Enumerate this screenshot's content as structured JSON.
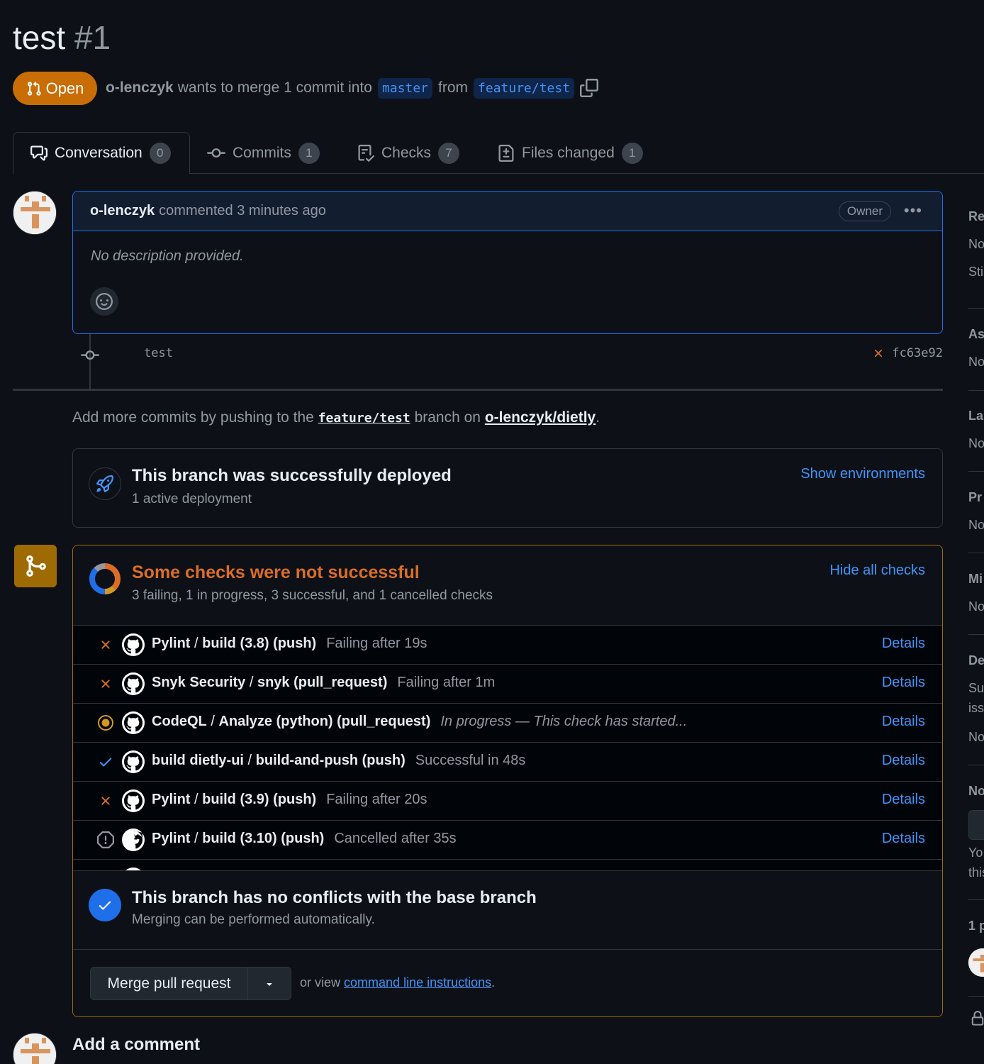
{
  "pr": {
    "title": "test",
    "number": "#1",
    "state": "Open",
    "author": "o-lenczyk",
    "meta_text": "wants to merge 1 commit into",
    "base_branch": "master",
    "from_text": "from",
    "head_branch": "feature/test"
  },
  "tabs": [
    {
      "label": "Conversation",
      "count": "0",
      "icon": "comment-discussion-icon"
    },
    {
      "label": "Commits",
      "count": "1",
      "icon": "git-commit-icon"
    },
    {
      "label": "Checks",
      "count": "7",
      "icon": "checklist-icon"
    },
    {
      "label": "Files changed",
      "count": "1",
      "icon": "file-diff-icon"
    }
  ],
  "comment": {
    "author": "o-lenczyk",
    "action": "commented 3 minutes ago",
    "badge": "Owner",
    "body": "No description provided."
  },
  "commit": {
    "message": "test",
    "sha": "fc63e92"
  },
  "push_hint": {
    "before": "Add more commits by pushing to the",
    "branch": "feature/test",
    "middle": "branch on",
    "owner": "o-lenczyk",
    "slash": "/",
    "repo": "dietly",
    "after": "."
  },
  "deployment": {
    "title": "This branch was successfully deployed",
    "subtitle": "1 active deployment",
    "link": "Show environments"
  },
  "checks": {
    "title": "Some checks were not successful",
    "subtitle": "3 failing, 1 in progress, 3 successful, and 1 cancelled checks",
    "link": "Hide all checks",
    "items": [
      {
        "status": "failing",
        "workflow": "Pylint",
        "job": "build (3.8) (push)",
        "desc": "Failing after 19s",
        "details": "Details"
      },
      {
        "status": "failing",
        "workflow": "Snyk Security",
        "job": "snyk (pull_request)",
        "desc": "Failing after 1m",
        "details": "Details"
      },
      {
        "status": "in-progress",
        "workflow": "CodeQL",
        "job": "Analyze (python) (pull_request)",
        "desc": "In progress — This check has started...",
        "details": "Details"
      },
      {
        "status": "success",
        "workflow": "build dietly-ui",
        "job": "build-and-push (push)",
        "desc": "Successful in 48s",
        "details": "Details"
      },
      {
        "status": "failing",
        "workflow": "Pylint",
        "job": "build (3.9) (push)",
        "desc": "Failing after 20s",
        "details": "Details"
      },
      {
        "status": "cancelled",
        "workflow": "Pylint",
        "job": "build (3.10) (push)",
        "desc": "Cancelled after 35s",
        "details": "Details"
      }
    ]
  },
  "conflicts": {
    "title": "This branch has no conflicts with the base branch",
    "subtitle": "Merging can be performed automatically."
  },
  "merge": {
    "button": "Merge pull request",
    "hint_before": "or view",
    "hint_link": "command line instructions",
    "hint_after": "."
  },
  "add_comment": "Add a comment",
  "sidebar": {
    "items": [
      "Re",
      "No",
      "Sti",
      "As",
      "No",
      "La",
      "No",
      "Pr",
      "No",
      "Mi",
      "No",
      "De",
      "Su",
      "iss",
      "No",
      "No",
      "Yo",
      "this",
      "1 p"
    ]
  },
  "colors": {
    "accent": "#4493f8",
    "open": "#c96d06",
    "warning_border": "#9e6a03",
    "failing": "#db6d28",
    "success": "#4493f8"
  }
}
